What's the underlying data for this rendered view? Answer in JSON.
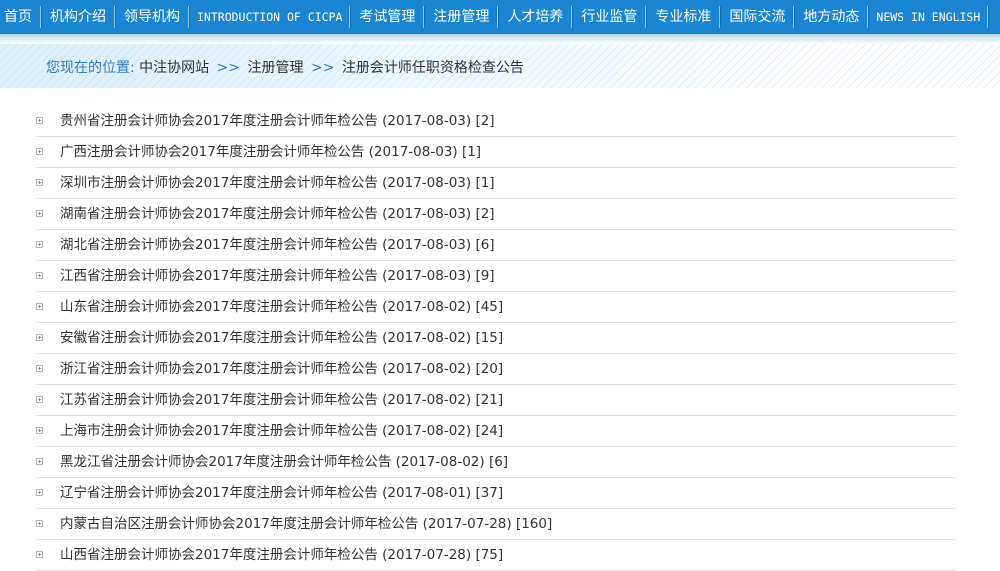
{
  "nav": {
    "items": [
      "首页",
      "机构介绍",
      "领导机构",
      "INTRODUCTION OF CICPA",
      "考试管理",
      "注册管理",
      "人才培养",
      "行业监管",
      "专业标准",
      "国际交流",
      "地方动态",
      "NEWS IN ENGLISH"
    ]
  },
  "breadcrumb": {
    "prefix": "您现在的位置:",
    "separator": ">>",
    "items": [
      "中注协网站",
      "注册管理",
      "注册会计师任职资格检查公告"
    ]
  },
  "list": [
    {
      "title": "贵州省注册会计师协会2017年度注册会计师年检公告",
      "date": "(2017-08-03)",
      "count": "[2]"
    },
    {
      "title": "广西注册会计师协会2017年度注册会计师年检公告",
      "date": "(2017-08-03)",
      "count": "[1]"
    },
    {
      "title": "深圳市注册会计师协会2017年度注册会计师年检公告",
      "date": "(2017-08-03)",
      "count": "[1]"
    },
    {
      "title": "湖南省注册会计师协会2017年度注册会计师年检公告",
      "date": "(2017-08-03)",
      "count": "[2]"
    },
    {
      "title": "湖北省注册会计师协会2017年度注册会计师年检公告",
      "date": "(2017-08-03)",
      "count": "[6]"
    },
    {
      "title": "江西省注册会计师协会2017年度注册会计师年检公告",
      "date": "(2017-08-03)",
      "count": "[9]"
    },
    {
      "title": "山东省注册会计师协会2017年度注册会计师年检公告",
      "date": "(2017-08-02)",
      "count": "[45]"
    },
    {
      "title": "安徽省注册会计师协会2017年度注册会计师年检公告",
      "date": "(2017-08-02)",
      "count": "[15]"
    },
    {
      "title": "浙江省注册会计师协会2017年度注册会计师年检公告",
      "date": "(2017-08-02)",
      "count": "[20]"
    },
    {
      "title": "江苏省注册会计师协会2017年度注册会计师年检公告",
      "date": "(2017-08-02)",
      "count": "[21]"
    },
    {
      "title": "上海市注册会计师协会2017年度注册会计师年检公告",
      "date": "(2017-08-02)",
      "count": "[24]"
    },
    {
      "title": "黑龙江省注册会计师协会2017年度注册会计师年检公告",
      "date": "(2017-08-02)",
      "count": "[6]"
    },
    {
      "title": "辽宁省注册会计师协会2017年度注册会计师年检公告",
      "date": "(2017-08-01)",
      "count": "[37]"
    },
    {
      "title": "内蒙古自治区注册会计师协会2017年度注册会计师年检公告",
      "date": "(2017-07-28)",
      "count": "[160]"
    },
    {
      "title": "山西省注册会计师协会2017年度注册会计师年检公告",
      "date": "(2017-07-28)",
      "count": "[75]"
    }
  ]
}
